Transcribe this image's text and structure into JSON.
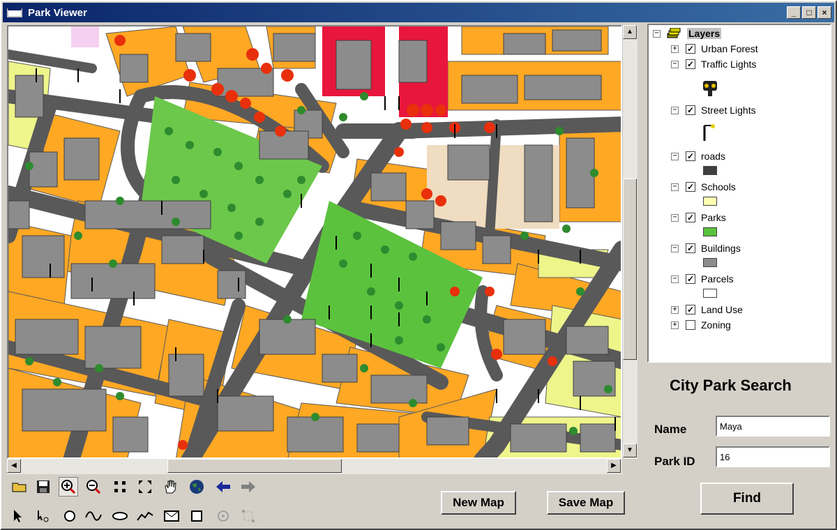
{
  "window": {
    "title": "Park Viewer",
    "controls": [
      "_",
      "□",
      "×"
    ]
  },
  "map": {
    "description_colors": {
      "road": "#595959",
      "parcel": "#ffa824",
      "building": "#8c8c8c",
      "park": "#5bc23e",
      "forest_red": "#e8300c",
      "school": "#ffffb0"
    }
  },
  "toolbar": {
    "row1": [
      "open-folder-icon",
      "save-disk-icon",
      "zoom-in-icon",
      "zoom-out-icon",
      "fixed-zoom-in-icon",
      "fixed-zoom-out-icon",
      "pan-hand-icon",
      "full-extent-globe-icon",
      "back-arrow-icon",
      "forward-arrow-icon"
    ],
    "row2": [
      "select-arrow-icon",
      "edit-vertex-icon",
      "circle-tool-icon",
      "curve-tool-icon",
      "ellipse-tool-icon",
      "polyline-tool-icon",
      "envelope-tool-icon",
      "rectangle-tool-icon",
      "rotate-tool-icon",
      "resize-tool-icon"
    ]
  },
  "buttons": {
    "new_map": "New Map",
    "save_map": "Save Map",
    "find": "Find"
  },
  "toc": {
    "root": "Layers",
    "layers": [
      {
        "label": "Urban Forest",
        "checked": true,
        "expander": "+"
      },
      {
        "label": "Traffic Lights",
        "checked": true,
        "expander": "−"
      },
      {
        "label": "Street Lights",
        "checked": true,
        "expander": "−"
      },
      {
        "label": "roads",
        "checked": true,
        "expander": "−",
        "swatch": "#404040"
      },
      {
        "label": "Schools",
        "checked": true,
        "expander": "−",
        "swatch": "#ffffb0"
      },
      {
        "label": "Parks",
        "checked": true,
        "expander": "−",
        "swatch": "#5bc23e"
      },
      {
        "label": "Buildings",
        "checked": true,
        "expander": "−",
        "swatch": "#8c8c8c"
      },
      {
        "label": "Parcels",
        "checked": true,
        "expander": "−",
        "swatch": "#ffffff"
      },
      {
        "label": "Land Use",
        "checked": true,
        "expander": "+"
      },
      {
        "label": "Zoning",
        "checked": false,
        "expander": "+"
      }
    ]
  },
  "search": {
    "title": "City Park Search",
    "name_label": "Name",
    "name_value": "Maya",
    "id_label": "Park ID",
    "id_value": "16"
  }
}
